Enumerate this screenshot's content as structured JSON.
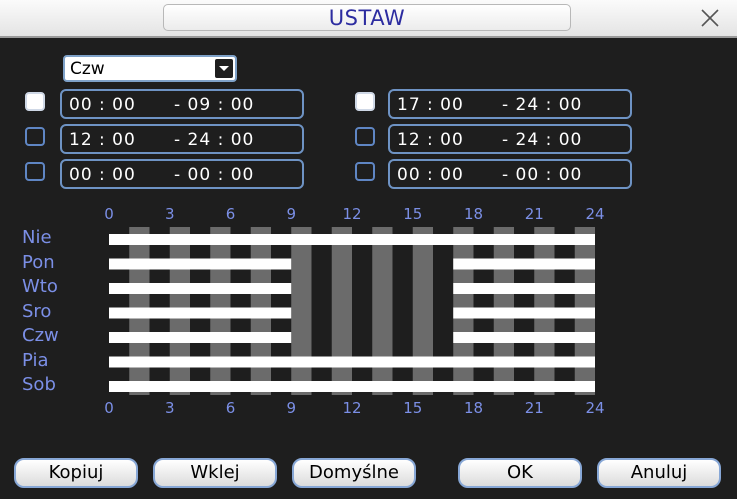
{
  "window": {
    "title": "USTAW"
  },
  "day_select": {
    "value": "Czw"
  },
  "periods": [
    {
      "checked": true,
      "start": "00 : 00",
      "end": "- 09 : 00"
    },
    {
      "checked": true,
      "start": "17 : 00",
      "end": "- 24 : 00"
    },
    {
      "checked": false,
      "start": "12 : 00",
      "end": "- 24 : 00"
    },
    {
      "checked": false,
      "start": "12 : 00",
      "end": "- 24 : 00"
    },
    {
      "checked": false,
      "start": "00 : 00",
      "end": "- 00 : 00"
    },
    {
      "checked": false,
      "start": "00 : 00",
      "end": "- 00 : 00"
    }
  ],
  "schedule": {
    "hour_labels": [
      "0",
      "3",
      "6",
      "9",
      "12",
      "15",
      "18",
      "21",
      "24"
    ],
    "days": [
      {
        "label": "Nie",
        "ranges": [
          [
            0,
            24
          ]
        ]
      },
      {
        "label": "Pon",
        "ranges": [
          [
            0,
            9
          ],
          [
            17,
            24
          ]
        ]
      },
      {
        "label": "Wto",
        "ranges": [
          [
            0,
            9
          ],
          [
            17,
            24
          ]
        ]
      },
      {
        "label": "Sro",
        "ranges": [
          [
            0,
            9
          ],
          [
            17,
            24
          ]
        ]
      },
      {
        "label": "Czw",
        "ranges": [
          [
            0,
            9
          ],
          [
            17,
            24
          ]
        ]
      },
      {
        "label": "Pia",
        "ranges": [
          [
            0,
            24
          ]
        ]
      },
      {
        "label": "Sob",
        "ranges": [
          [
            0,
            24
          ]
        ]
      }
    ]
  },
  "buttons": {
    "copy": "Kopiuj",
    "paste": "Wklej",
    "default": "Domyślne",
    "ok": "OK",
    "cancel": "Anuluj"
  },
  "colors": {
    "accent": "#7b8fe6",
    "border": "#6e93c4",
    "schedule_bar": "#ffffff",
    "hour_stripe": "#6b6b6b"
  }
}
